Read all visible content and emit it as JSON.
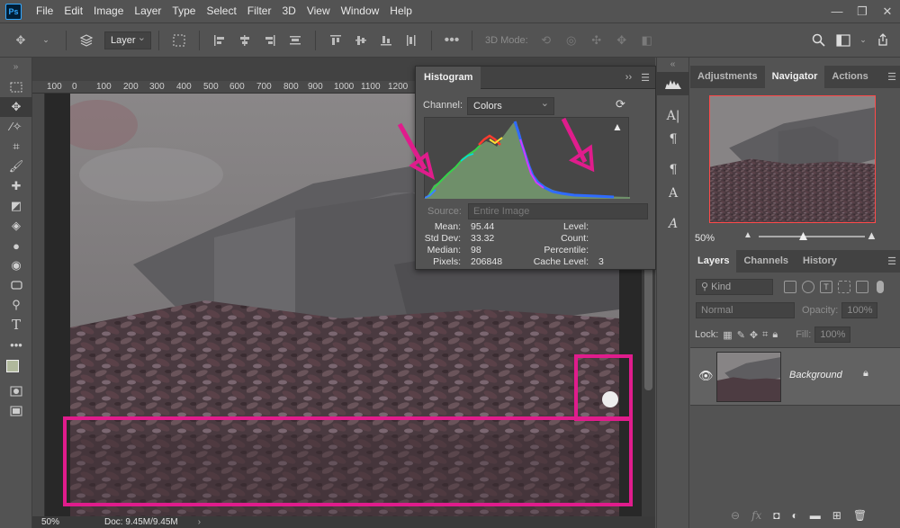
{
  "app": {
    "logo": "Ps",
    "accent": "#31a8ff"
  },
  "menu": [
    "File",
    "Edit",
    "Image",
    "Layer",
    "Type",
    "Select",
    "Filter",
    "3D",
    "View",
    "Window",
    "Help"
  ],
  "window_controls": {
    "minimize": "—",
    "restore": "❐",
    "close": "✕"
  },
  "options_bar": {
    "auto_select_target": "Layer",
    "mode_label": "3D Mode:"
  },
  "ruler": {
    "h_ticks": [
      "100",
      "0",
      "100",
      "200",
      "300",
      "400",
      "500",
      "600",
      "700",
      "800",
      "900",
      "1000",
      "1100",
      "1200"
    ]
  },
  "status": {
    "zoom": "50%",
    "doc": "Doc: 9.45M/9.45M",
    "more": "›"
  },
  "histogram": {
    "tab": "Histogram",
    "channel_label": "Channel:",
    "channel_value": "Colors",
    "source_label": "Source:",
    "source_value": "Entire Image",
    "stats": {
      "mean_label": "Mean:",
      "mean": "95.44",
      "std_label": "Std Dev:",
      "std": "33.32",
      "median_label": "Median:",
      "median": "98",
      "pixels_label": "Pixels:",
      "pixels": "206848",
      "level_label": "Level:",
      "level": "",
      "count_label": "Count:",
      "count": "",
      "percentile_label": "Percentile:",
      "percentile": "",
      "cache_label": "Cache Level:",
      "cache": "3"
    },
    "warning_icon": "warning-icon"
  },
  "nav_panel": {
    "tabs": [
      "Adjustments",
      "Navigator",
      "Actions"
    ],
    "active_tab": "Navigator",
    "zoom": "50%"
  },
  "layers_panel": {
    "tabs": [
      "Layers",
      "Channels",
      "History"
    ],
    "active_tab": "Layers",
    "filter_label": "Kind",
    "blend_mode": "Normal",
    "opacity_label": "Opacity:",
    "opacity": "100%",
    "lock_label": "Lock:",
    "fill_label": "Fill:",
    "fill": "100%",
    "layer_name": "Background"
  },
  "annotations": {
    "highlight_color": "#e01c8c"
  }
}
